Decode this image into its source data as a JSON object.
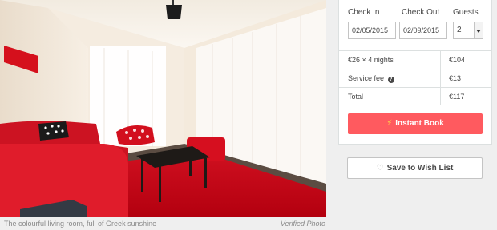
{
  "photo": {
    "caption": "The colourful living room, full of Greek sunshine",
    "badge": "Verified Photo"
  },
  "booking": {
    "check_in": {
      "label": "Check In",
      "value": "02/05/2015"
    },
    "check_out": {
      "label": "Check Out",
      "value": "02/09/2015"
    },
    "guests": {
      "label": "Guests",
      "value": "2"
    },
    "price_rows": [
      {
        "label": "€26 × 4 nights",
        "value": "€104"
      },
      {
        "label": "Service fee",
        "value": "€13"
      },
      {
        "label": "Total",
        "value": "€117"
      }
    ],
    "instant_book_label": "Instant Book",
    "wishlist_label": "Save to Wish List"
  },
  "colors": {
    "accent": "#ff5a5f",
    "background": "#efefef",
    "border": "#dce0e0"
  },
  "icons": {
    "help": "question-circle-icon",
    "bolt": "lightning-bolt-icon",
    "heart": "heart-outline-icon",
    "select_arrow": "chevron-down-icon"
  }
}
